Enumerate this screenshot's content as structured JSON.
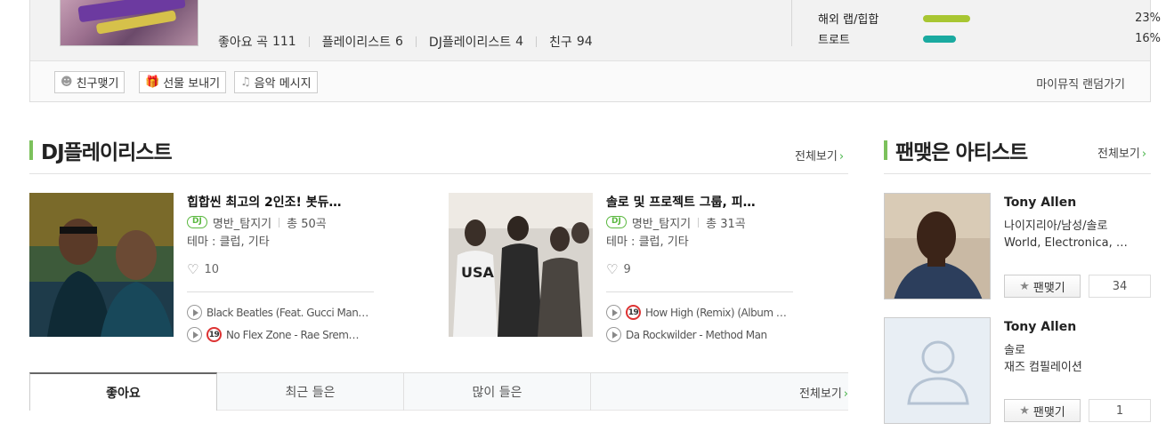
{
  "profile": {
    "stats": [
      {
        "label": "좋아요 곡",
        "value": "111"
      },
      {
        "label": "플레이리스트",
        "value": "6"
      },
      {
        "label": "DJ플레이리스트",
        "value": "4"
      },
      {
        "label": "친구",
        "value": "94"
      }
    ],
    "genres": [
      {
        "label": "해외 랩/힙합",
        "pct": "23%",
        "share": 0.23,
        "color": "#a8c632"
      },
      {
        "label": "트로트",
        "pct": "16%",
        "share": 0.16,
        "color": "#1aaaa0"
      }
    ],
    "buttons": [
      {
        "label": "친구맺기",
        "icon": "person-icon"
      },
      {
        "label": "선물 보내기",
        "icon": "gift-icon"
      },
      {
        "label": "음악 메시지",
        "icon": "music-note-icon"
      }
    ],
    "random_link": "마이뮤직 랜덤가기"
  },
  "dj_section": {
    "title": "DJ플레이리스트",
    "more": "전체보기",
    "playlists": [
      {
        "title": "힙합씬 최고의 2인조! 봇듀…",
        "badge": "DJ",
        "author": "명반_탐지기",
        "count": "총 50곡",
        "theme": "테마 : 클럽, 기타",
        "likes": "10",
        "tracks": [
          {
            "text": "Black Beatles (Feat. Gucci Man…",
            "adult": false
          },
          {
            "text": "No Flex Zone - Rae Srem…",
            "adult": true,
            "adult_label": "19"
          }
        ]
      },
      {
        "title": "솔로 및 프로젝트 그룹, 피…",
        "badge": "DJ",
        "author": "명반_탐지기",
        "count": "총 31곡",
        "theme": "테마 : 클럽, 기타",
        "likes": "9",
        "tracks": [
          {
            "text": "How High (Remix) (Album V…",
            "adult": true,
            "adult_label": "19"
          },
          {
            "text": "Da Rockwilder - Method Man",
            "adult": false
          }
        ]
      }
    ]
  },
  "tabs": {
    "items": [
      "좋아요",
      "최근 들은",
      "많이 들은"
    ],
    "active": 0,
    "more": "전체보기"
  },
  "artist_section": {
    "title": "팬맺은 아티스트",
    "more": "전체보기",
    "artists": [
      {
        "name": "Tony Allen",
        "desc1": "나이지리아/남성/솔로",
        "desc2": "World, Electronica, …",
        "fan_label": "팬맺기",
        "fans": "34",
        "photo": true
      },
      {
        "name": "Tony Allen",
        "desc1": "솔로",
        "desc2": "재즈 컴필레이션",
        "fan_label": "팬맺기",
        "fans": "1",
        "photo": false
      }
    ]
  }
}
